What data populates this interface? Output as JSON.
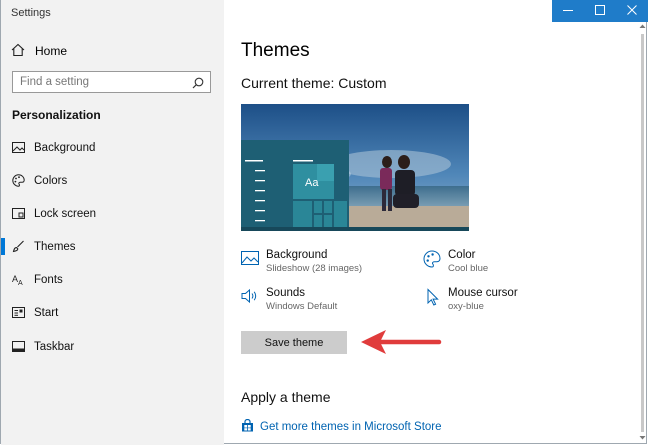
{
  "window": {
    "title": "Settings"
  },
  "sidebar": {
    "home_label": "Home",
    "search_placeholder": "Find a setting",
    "section_title": "Personalization",
    "items": [
      {
        "label": "Background",
        "icon": "picture-icon"
      },
      {
        "label": "Colors",
        "icon": "palette-icon"
      },
      {
        "label": "Lock screen",
        "icon": "lock-screen-icon"
      },
      {
        "label": "Themes",
        "icon": "brush-icon",
        "active": true
      },
      {
        "label": "Fonts",
        "icon": "font-icon"
      },
      {
        "label": "Start",
        "icon": "start-icon"
      },
      {
        "label": "Taskbar",
        "icon": "taskbar-icon"
      }
    ]
  },
  "main": {
    "title": "Themes",
    "current_theme": "Current theme: Custom",
    "preview": {
      "sample_text": "Aa"
    },
    "properties": [
      {
        "label": "Background",
        "value": "Slideshow (28 images)",
        "icon": "picture-icon"
      },
      {
        "label": "Color",
        "value": "Cool blue",
        "icon": "palette-icon"
      },
      {
        "label": "Sounds",
        "value": "Windows Default",
        "icon": "speaker-icon"
      },
      {
        "label": "Mouse cursor",
        "value": "oxy-blue",
        "icon": "cursor-icon"
      }
    ],
    "save_button": "Save theme",
    "apply_title": "Apply a theme",
    "store_link": "Get more themes in Microsoft Store"
  },
  "colors": {
    "accent": "#0078d7",
    "link": "#0063b1",
    "annotation_arrow": "#e03c3c",
    "caption_bar": "#1f7cc9"
  }
}
